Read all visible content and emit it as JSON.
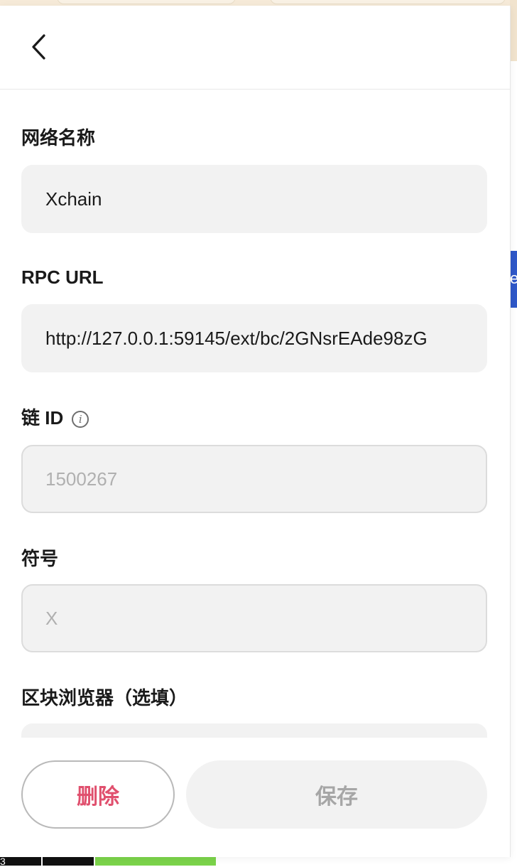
{
  "background": {
    "side_tab_text": "e",
    "bottom_text": "3"
  },
  "header": {
    "back_icon": "chevron-left-icon"
  },
  "fields": {
    "network_name": {
      "label": "网络名称",
      "value": "Xchain"
    },
    "rpc_url": {
      "label": "RPC URL",
      "value": "http://127.0.0.1:59145/ext/bc/2GNsrEAde98zG"
    },
    "chain_id": {
      "label": "链 ID",
      "info_icon": "info-icon",
      "value": "1500267"
    },
    "symbol": {
      "label": "符号",
      "value": "X"
    },
    "block_explorer": {
      "label": "区块浏览器（选填）",
      "value": ""
    }
  },
  "footer": {
    "delete_label": "删除",
    "save_label": "保存"
  },
  "colors": {
    "delete_text": "#e0506e",
    "save_disabled_bg": "#f2f2f2",
    "save_disabled_text": "#a6a6a6",
    "field_bg": "#f2f2f2",
    "side_tab": "#2f58c8"
  }
}
